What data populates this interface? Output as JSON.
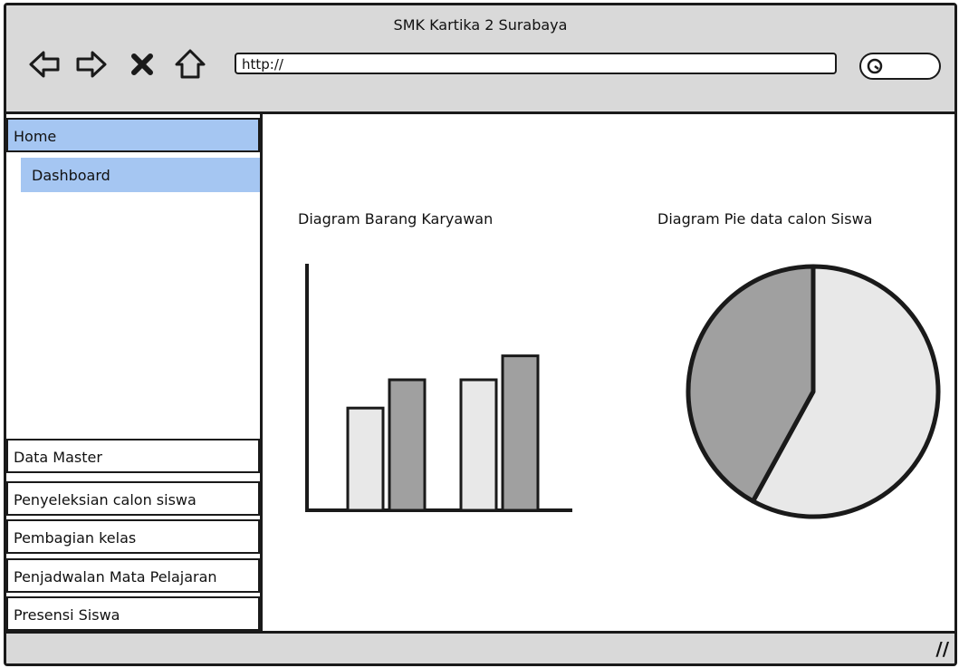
{
  "window": {
    "title": "SMK Kartika 2 Surabaya"
  },
  "toolbar": {
    "address": "http://",
    "icons": [
      "back-arrow-icon",
      "forward-arrow-icon",
      "close-icon",
      "home-icon",
      "search-icon"
    ]
  },
  "sidebar": {
    "home_label": "Home",
    "dashboard_label": "Dashboard",
    "items": [
      {
        "label": "Data Master"
      },
      {
        "label": "Penyeleksian calon siswa"
      },
      {
        "label": "Pembagian kelas"
      },
      {
        "label": "Penjadwalan Mata Pelajaran"
      },
      {
        "label": "Presensi Siswa"
      }
    ]
  },
  "colors": {
    "selected": "#a5c6f2",
    "chrome": "#d9d9d9",
    "light_fill": "#e8e8e8",
    "dark_fill": "#a0a0a0"
  },
  "chart_data": [
    {
      "type": "bar",
      "title": "Diagram Barang Karyawan",
      "categories": [
        "",
        ""
      ],
      "series": [
        {
          "values": [
            47,
            60
          ]
        },
        {
          "values": [
            60,
            71
          ]
        }
      ],
      "ylim": [
        0,
        100
      ]
    },
    {
      "type": "pie",
      "title": "Diagram Pie data calon Siswa",
      "values": [
        58,
        42
      ]
    }
  ]
}
